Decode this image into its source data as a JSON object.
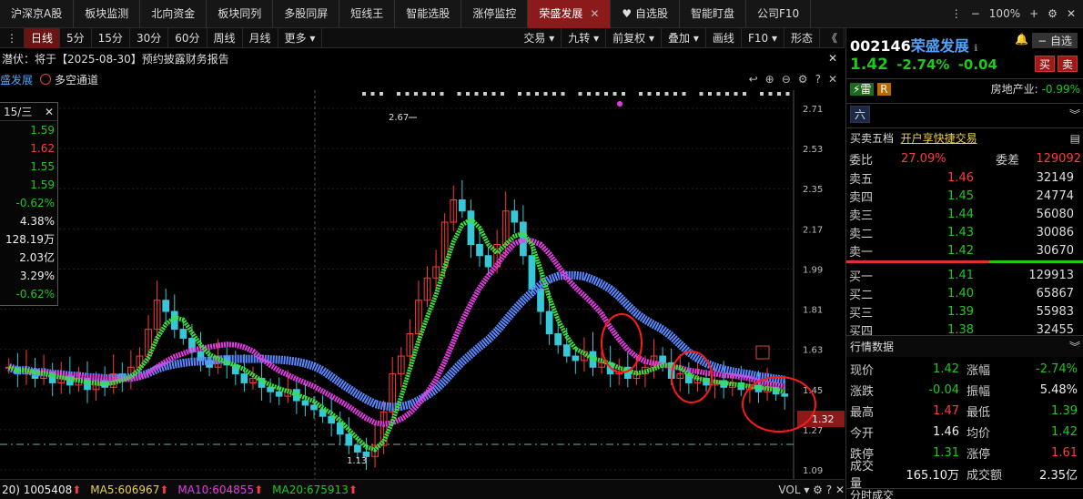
{
  "nav": {
    "tabs": [
      "沪深京A股",
      "板块监测",
      "北向资金",
      "板块同列",
      "多股同屏",
      "短线王",
      "智能选股",
      "涨停监控",
      "荣盛发展",
      "自选股",
      "智能盯盘",
      "公司F10"
    ],
    "active_index": 8,
    "zoom": "100%"
  },
  "toolbar": {
    "periods": [
      "日线",
      "5分",
      "15分",
      "30分",
      "60分",
      "周线",
      "月线",
      "更多"
    ],
    "active_index": 0,
    "right": [
      "交易",
      "九转",
      "前复权",
      "叠加",
      "画线",
      "F10",
      "形态"
    ]
  },
  "info": {
    "text": "潜伏：将于【2025-08-30】预约披露财务报告"
  },
  "legend": {
    "stock": "盛发展",
    "indicator": "多空通道"
  },
  "tooltip": {
    "date": "15/三",
    "values": [
      {
        "v": "1.59",
        "c": "g"
      },
      {
        "v": "1.62",
        "c": "r"
      },
      {
        "v": "1.55",
        "c": "g"
      },
      {
        "v": "1.59",
        "c": "g"
      },
      {
        "v": "-0.62%",
        "c": "g"
      },
      {
        "v": "4.38%",
        "c": "w"
      },
      {
        "v": "128.19万",
        "c": "w"
      },
      {
        "v": "2.03亿",
        "c": "w"
      },
      {
        "v": "3.29%",
        "c": "w"
      },
      {
        "v": "-0.62%",
        "c": "g"
      }
    ]
  },
  "chart_data": {
    "type": "candlestick",
    "y_ticks": [
      "2.71",
      "2.53",
      "2.35",
      "2.17",
      "1.99",
      "1.81",
      "1.63",
      "1.45",
      "1.27",
      "1.09"
    ],
    "ylim": [
      1.09,
      2.71
    ],
    "high_label": "2.67",
    "low_label": "1.13",
    "current_price": "1.32",
    "closes": [
      1.55,
      1.52,
      1.54,
      1.5,
      1.53,
      1.48,
      1.51,
      1.47,
      1.5,
      1.45,
      1.49,
      1.46,
      1.52,
      1.5,
      1.55,
      1.6,
      1.72,
      1.85,
      1.8,
      1.72,
      1.68,
      1.62,
      1.58,
      1.55,
      1.6,
      1.56,
      1.52,
      1.48,
      1.5,
      1.46,
      1.44,
      1.42,
      1.45,
      1.4,
      1.38,
      1.36,
      1.33,
      1.3,
      1.25,
      1.2,
      1.17,
      1.15,
      1.2,
      1.35,
      1.52,
      1.6,
      1.7,
      1.85,
      1.95,
      2.0,
      2.2,
      2.3,
      2.25,
      2.1,
      2.05,
      2.0,
      2.1,
      2.25,
      2.2,
      2.05,
      1.9,
      1.8,
      1.7,
      1.65,
      1.6,
      1.58,
      1.62,
      1.55,
      1.57,
      1.52,
      1.55,
      1.5,
      1.52,
      1.55,
      1.6,
      1.57,
      1.5,
      1.52,
      1.48,
      1.5,
      1.47,
      1.49,
      1.46,
      1.48,
      1.45,
      1.47,
      1.44,
      1.46,
      1.43,
      1.42
    ]
  },
  "bottom": {
    "vol": "1005408",
    "ma5": "MA5:606967",
    "ma10": "MA10:604855",
    "ma20": "MA20:675913",
    "vol_label": "VOL"
  },
  "quote": {
    "code": "002146",
    "name": "荣盛发展",
    "price": "1.42",
    "pct": "-2.74%",
    "chg": "-0.04",
    "buy": "买",
    "sell": "卖",
    "fav": "自选",
    "industry_label": "房地产业:",
    "industry_pct": "-0.99%",
    "six": "六"
  },
  "orderbook": {
    "title": "买卖五档",
    "link": "开户享快捷交易",
    "wb_label": "委比",
    "wb": "27.09%",
    "wc_label": "委差",
    "wc": "129092",
    "asks": [
      {
        "l": "卖五",
        "p": "1.46",
        "v": "32149",
        "c": "r"
      },
      {
        "l": "卖四",
        "p": "1.45",
        "v": "24774",
        "c": "g"
      },
      {
        "l": "卖三",
        "p": "1.44",
        "v": "56080",
        "c": "g"
      },
      {
        "l": "卖二",
        "p": "1.43",
        "v": "30086",
        "c": "g"
      },
      {
        "l": "卖一",
        "p": "1.42",
        "v": "30670",
        "c": "g"
      }
    ],
    "bids": [
      {
        "l": "买一",
        "p": "1.41",
        "v": "129913",
        "c": "g"
      },
      {
        "l": "买二",
        "p": "1.40",
        "v": "65867",
        "c": "g"
      },
      {
        "l": "买三",
        "p": "1.39",
        "v": "55983",
        "c": "g"
      },
      {
        "l": "买四",
        "p": "1.38",
        "v": "32455",
        "c": "g"
      }
    ]
  },
  "market": {
    "title": "行情数据",
    "rows": [
      {
        "k": "现价",
        "v": "1.42",
        "vc": "g",
        "k2": "涨幅",
        "v2": "-2.74%",
        "v2c": "g"
      },
      {
        "k": "涨跌",
        "v": "-0.04",
        "vc": "g",
        "k2": "振幅",
        "v2": "5.48%",
        "v2c": "w"
      },
      {
        "k": "最高",
        "v": "1.47",
        "vc": "r",
        "k2": "最低",
        "v2": "1.39",
        "v2c": "g"
      },
      {
        "k": "今开",
        "v": "1.46",
        "vc": "w",
        "k2": "均价",
        "v2": "1.42",
        "v2c": "g"
      },
      {
        "k": "跌停",
        "v": "1.31",
        "vc": "g",
        "k2": "涨停",
        "v2": "1.61",
        "v2c": "r"
      },
      {
        "k": "成交量",
        "v": "165.10万",
        "vc": "w",
        "k2": "成交额",
        "v2": "2.35亿",
        "v2c": "w"
      }
    ]
  }
}
